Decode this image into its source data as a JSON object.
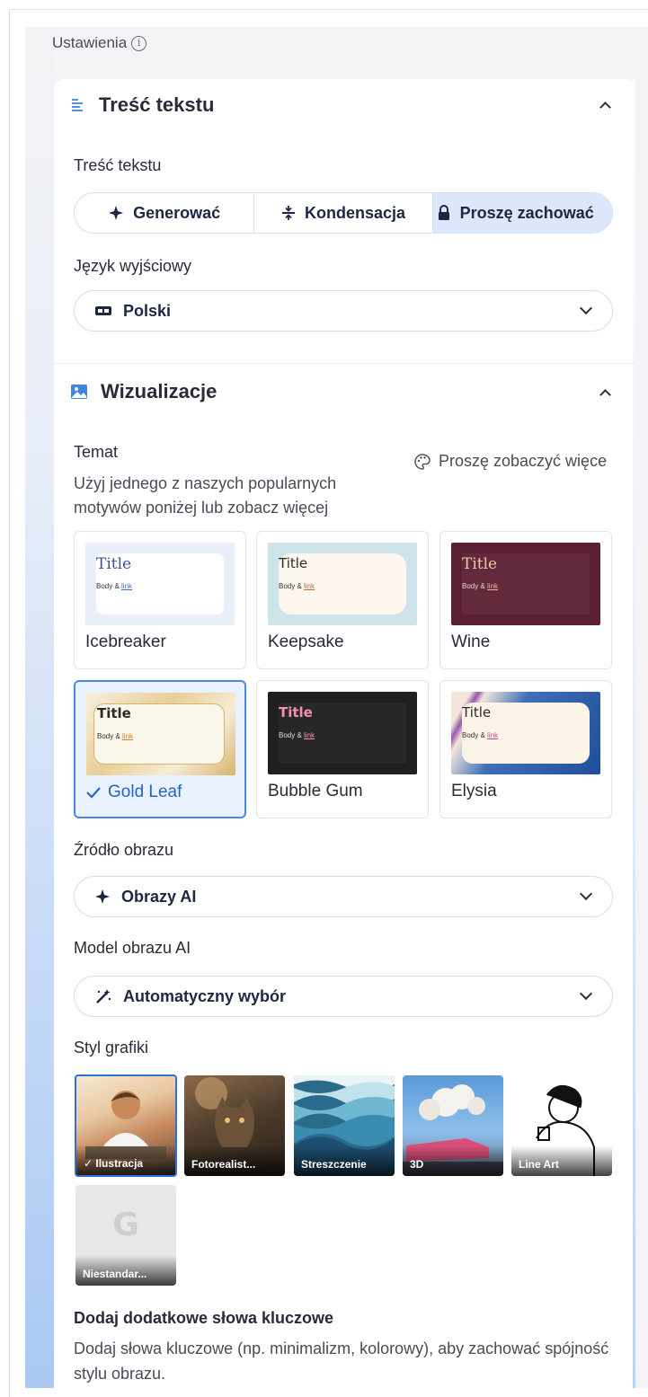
{
  "header": {
    "title": "Ustawienia",
    "info_icon": "i"
  },
  "text_content": {
    "section_title": "Treść tekstu",
    "field_label": "Treść tekstu",
    "modes": [
      {
        "icon": "sparkle-icon",
        "label": "Generować"
      },
      {
        "icon": "condense-icon",
        "label": "Kondensacja"
      },
      {
        "icon": "lock-icon",
        "label": "Proszę zachować"
      }
    ],
    "selected_mode": "Proszę zachować",
    "language_label": "Język wyjściowy",
    "language_value": "Polski"
  },
  "visuals": {
    "section_title": "Wizualizacje",
    "theme_label": "Temat",
    "theme_desc_line1": "Użyj jednego z naszych popularnych",
    "theme_desc_line2": "motywów poniżej lub zobacz więcej",
    "see_more": "Proszę zobaczyć więce",
    "themes": [
      {
        "name": "Icebreaker",
        "title": "Title",
        "body": "Body &",
        "link": "link",
        "bg": "#e8eff8",
        "card": "#ffffff",
        "title_color": "#3a4fa0"
      },
      {
        "name": "Keepsake",
        "title": "Title",
        "body": "Body &",
        "link": "link",
        "bg": "#cfe4ea",
        "card": "#fdf7ef",
        "title_color": "#2a2a2a"
      },
      {
        "name": "Wine",
        "title": "Title",
        "body": "Body &",
        "link": "link",
        "bg": "#5a1f34",
        "card": "#5e2538",
        "title_color": "#f0c8b0"
      },
      {
        "name": "Gold Leaf",
        "title": "Title",
        "body": "Body &",
        "link": "link",
        "bg": "#f3e7cf",
        "card": "#fbf6ea",
        "title_color": "#2a2a2a"
      },
      {
        "name": "Bubble Gum",
        "title": "Title",
        "body": "Body &",
        "link": "link",
        "bg": "#1f1f1f",
        "card": "#262626",
        "title_color": "#f58fb6"
      },
      {
        "name": "Elysia",
        "title": "Title",
        "body": "Body &",
        "link": "link",
        "bg": "#dfe8f6",
        "card": "#fbf3e6",
        "title_color": "#2a2a2a"
      }
    ],
    "selected_theme": "Gold Leaf",
    "image_source_label": "Źródło obrazu",
    "image_source_value": "Obrazy AI",
    "image_model_label": "Model obrazu AI",
    "image_model_value": "Automatyczny wybór",
    "graphic_style_label": "Styl grafiki",
    "styles": [
      {
        "label": "Ilustracja",
        "selected": true
      },
      {
        "label": "Fotorealist..."
      },
      {
        "label": "Streszczenie"
      },
      {
        "label": "3D"
      },
      {
        "label": "Line Art"
      },
      {
        "label": "Niestandar..."
      }
    ],
    "keywords_title": "Dodaj dodatkowe słowa kluczowe",
    "keywords_desc": "Dodaj słowa kluczowe (np. minimalizm, kolorowy), aby zachować spójność stylu obrazu."
  }
}
